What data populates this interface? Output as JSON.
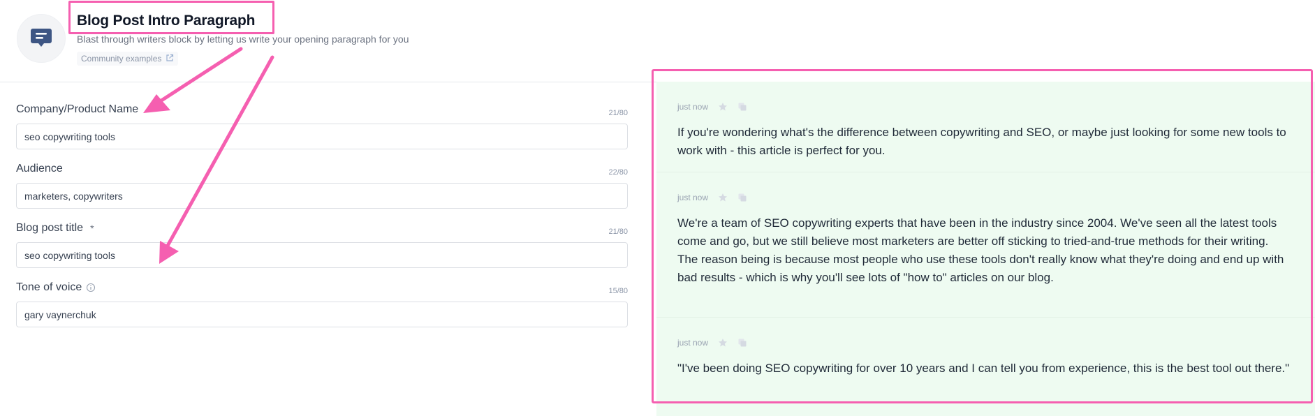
{
  "header": {
    "title": "Blog Post Intro Paragraph",
    "subtitle": "Blast through writers block by letting us write your opening paragraph for you",
    "community_link": "Community examples",
    "icon": "chat-message-icon"
  },
  "form": {
    "fields": [
      {
        "label": "Company/Product Name",
        "required": false,
        "info": false,
        "count": "21/80",
        "value": "seo copywriting tools"
      },
      {
        "label": "Audience",
        "required": false,
        "info": false,
        "count": "22/80",
        "value": "marketers, copywriters"
      },
      {
        "label": "Blog post title",
        "required": true,
        "info": false,
        "count": "21/80",
        "value": "seo copywriting tools"
      },
      {
        "label": "Tone of voice",
        "required": false,
        "info": true,
        "count": "15/80",
        "value": "gary vaynerchuk"
      }
    ],
    "required_marker": "*"
  },
  "results": [
    {
      "time": "just now",
      "text": "If you're wondering what's the difference between copywriting and SEO, or maybe just looking for some new tools to work with - this article is perfect for you."
    },
    {
      "time": "just now",
      "text": "We're a team of SEO copywriting experts that have been in the industry since 2004. We've seen all the latest tools come and go, but we still believe most marketers are better off sticking to tried-and-true methods for their writing.\nThe reason being is because most people who use these tools don't really know what they're doing and end up with bad results - which is why you'll see lots of \"how to\" articles on our blog."
    },
    {
      "time": "just now",
      "text": "\"I've been doing SEO copywriting for over 10 years and I can tell you from experience, this is the best tool out there.\""
    }
  ],
  "colors": {
    "annotation": "#f55fb0",
    "results_bg": "#eefbf1",
    "icon_blue": "#3e5684"
  }
}
